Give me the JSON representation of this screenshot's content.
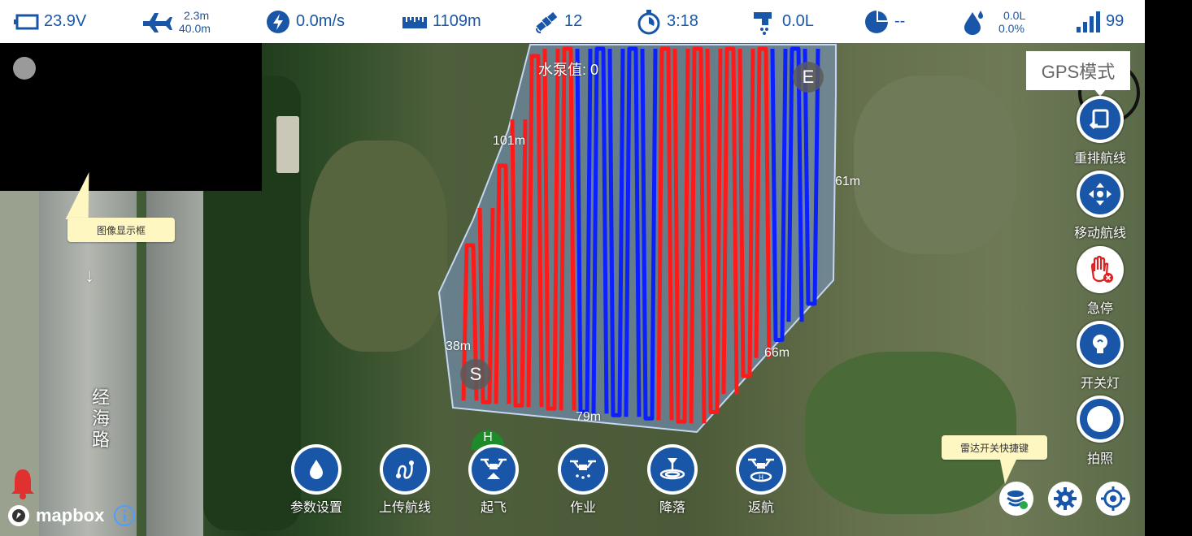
{
  "statusbar": {
    "battery_voltage": "23.9V",
    "altitude_top": "2.3m",
    "altitude_bottom": "40.0m",
    "speed": "0.0m/s",
    "distance": "1109m",
    "satellites": "12",
    "flight_time": "3:18",
    "flow": "0.0L",
    "area": "--",
    "liquid_top": "0.0L",
    "liquid_bottom": "0.0%",
    "signal": "99"
  },
  "video": {
    "tooltip": "图像显示框"
  },
  "map": {
    "pump_value": "水泵值: 0",
    "edge_labels": {
      "top_left": "101m",
      "right": "61m",
      "left": "38m",
      "bottom_right": "66m",
      "bottom": "79m"
    },
    "start_marker": "S",
    "end_marker": "E",
    "home_marker": "H",
    "street_name": "经海路",
    "north_arrow": "↓",
    "attribution": "mapbox",
    "colors": {
      "route_red": "#ff1a1a",
      "route_blue": "#0b1fff",
      "field_fill": "#7ea0d8"
    }
  },
  "right_panel": {
    "gps_mode": "GPS模式",
    "buttons": [
      {
        "label": "重排航线",
        "icon": "reorder-icon"
      },
      {
        "label": "移动航线",
        "icon": "move-icon"
      },
      {
        "label": "急停",
        "icon": "stop-hand-icon"
      },
      {
        "label": "开关灯",
        "icon": "light-icon"
      },
      {
        "label": "拍照",
        "icon": "camera-icon"
      }
    ]
  },
  "bottom_actions": [
    {
      "label": "参数设置",
      "icon": "drop-icon"
    },
    {
      "label": "上传航线",
      "icon": "route-icon"
    },
    {
      "label": "起飞",
      "icon": "takeoff-icon"
    },
    {
      "label": "作业",
      "icon": "work-icon"
    },
    {
      "label": "降落",
      "icon": "land-icon"
    },
    {
      "label": "返航",
      "icon": "return-icon"
    }
  ],
  "bottom_right": {
    "radar_tooltip": "雷达开关快捷键"
  }
}
